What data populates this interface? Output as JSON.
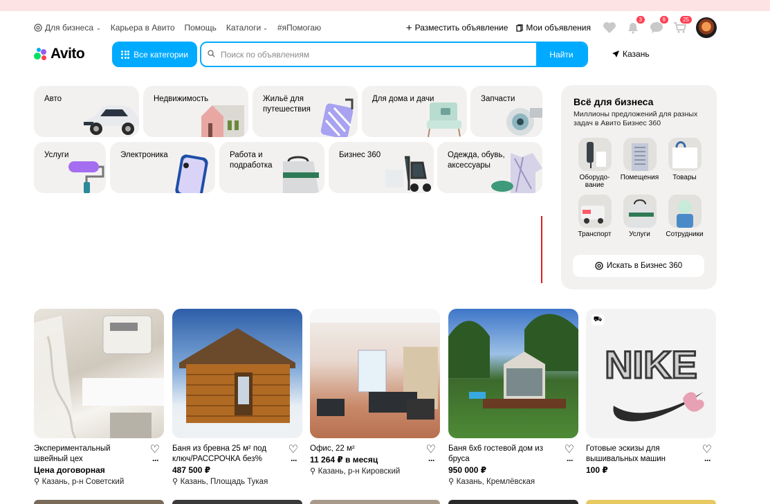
{
  "nav": {
    "business": "Для бизнеса",
    "career": "Карьера в Авито",
    "help": "Помощь",
    "catalogs": "Каталоги",
    "ipomogayu": "#яПомогаю",
    "post_ad": "Разместить объявление",
    "my_ads": "Мои объявления",
    "notif_count": "3",
    "messages_count": "9",
    "cart_count": "25"
  },
  "logo": "Avito",
  "all_categories": "Все категории",
  "search": {
    "placeholder": "Поиск по объявлениям",
    "button": "Найти"
  },
  "city": "Казань",
  "categories": [
    {
      "label": "Авто"
    },
    {
      "label": "Недвижимость"
    },
    {
      "label": "Жильё для путешествия"
    },
    {
      "label": "Для дома и дачи"
    },
    {
      "label": "Запчасти"
    },
    {
      "label": "Услуги"
    },
    {
      "label": "Электроника"
    },
    {
      "label": "Работа и подработка"
    },
    {
      "label": "Бизнес 360"
    },
    {
      "label": "Одежда, обувь, аксессуары"
    }
  ],
  "business": {
    "title": "Всё для бизнеса",
    "subtitle": "Миллионы предложений для разных задач в Авито Бизнес 360",
    "items": [
      {
        "label": "Оборудо-вание"
      },
      {
        "label": "Помещения"
      },
      {
        "label": "Товары"
      },
      {
        "label": "Транспорт"
      },
      {
        "label": "Услуги"
      },
      {
        "label": "Сотрудники"
      }
    ],
    "button": "Искать в Бизнес 360"
  },
  "listings": [
    {
      "title": "Экспериментальный швейный цех",
      "price": "Цена договорная",
      "location": "Казань, р-н Советский"
    },
    {
      "title": "Баня из бревна 25 м² под ключ/РАССРОЧКА без%",
      "price": "487 500 ₽",
      "location": "Казань, Площадь Тукая"
    },
    {
      "title": "Офис, 22 м²",
      "price": "11 264 ₽ в месяц",
      "location": "Казань, р-н Кировский"
    },
    {
      "title": "Баня 6х6 гостевой дом из бруса",
      "price": "950 000 ₽",
      "location": "Казань, Кремлёвская"
    },
    {
      "title": "Готовые эскизы для вышивальных машин",
      "price": "100 ₽",
      "location": ""
    }
  ],
  "nike_text": "NIKE",
  "colors": {
    "accent": "#00aaff",
    "badge": "#ff4053",
    "card_bg": "#f2f1f0"
  }
}
